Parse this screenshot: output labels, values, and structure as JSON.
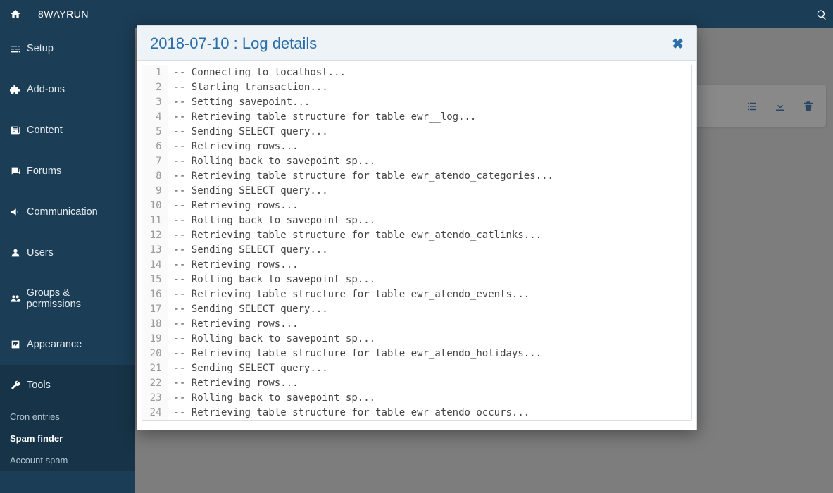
{
  "topbar": {
    "brand": "8WAYRUN"
  },
  "sidebar": {
    "items": [
      {
        "label": "Setup",
        "icon": "sliders"
      },
      {
        "label": "Add-ons",
        "icon": "puzzle"
      },
      {
        "label": "Content",
        "icon": "newspaper"
      },
      {
        "label": "Forums",
        "icon": "comments"
      },
      {
        "label": "Communication",
        "icon": "bullhorn"
      },
      {
        "label": "Users",
        "icon": "user"
      },
      {
        "label": "Groups & permissions",
        "icon": "group"
      },
      {
        "label": "Appearance",
        "icon": "image"
      },
      {
        "label": "Tools",
        "icon": "wrench"
      }
    ],
    "sub": [
      {
        "label": "Cron entries",
        "active": false
      },
      {
        "label": "Spam finder",
        "active": true
      },
      {
        "label": "Account spam",
        "active": false
      }
    ]
  },
  "card_actions": {
    "list": "list-icon",
    "download": "download-icon",
    "trash": "trash-icon"
  },
  "modal": {
    "title": "2018-07-10 : Log details",
    "lines": [
      "-- Connecting to localhost...",
      "-- Starting transaction...",
      "-- Setting savepoint...",
      "-- Retrieving table structure for table ewr__log...",
      "-- Sending SELECT query...",
      "-- Retrieving rows...",
      "-- Rolling back to savepoint sp...",
      "-- Retrieving table structure for table ewr_atendo_categories...",
      "-- Sending SELECT query...",
      "-- Retrieving rows...",
      "-- Rolling back to savepoint sp...",
      "-- Retrieving table structure for table ewr_atendo_catlinks...",
      "-- Sending SELECT query...",
      "-- Retrieving rows...",
      "-- Rolling back to savepoint sp...",
      "-- Retrieving table structure for table ewr_atendo_events...",
      "-- Sending SELECT query...",
      "-- Retrieving rows...",
      "-- Rolling back to savepoint sp...",
      "-- Retrieving table structure for table ewr_atendo_holidays...",
      "-- Sending SELECT query...",
      "-- Retrieving rows...",
      "-- Rolling back to savepoint sp...",
      "-- Retrieving table structure for table ewr_atendo_occurs..."
    ]
  }
}
